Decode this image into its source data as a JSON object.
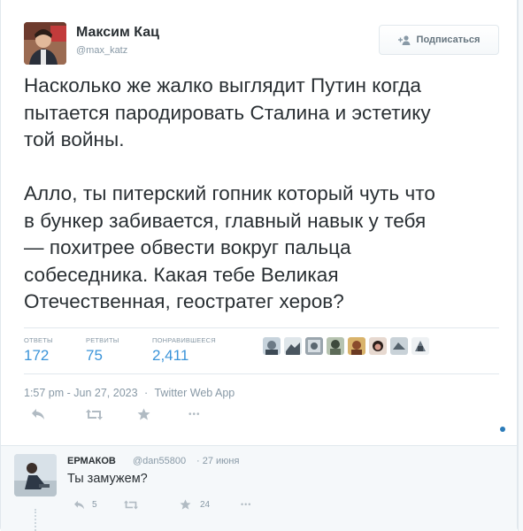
{
  "user": {
    "name": "Максим Кац",
    "handle": "@max_katz",
    "follow_label": "Подписаться"
  },
  "tweet": {
    "text": "Насколько же жалко выглядит Путин когда\nпытается пародировать Сталина и эстетику\nтой войны.\n\nАлло, ты питерский гопник который чуть что\nв бункер забивается, главный навык у тебя\n— похитрее обвести вокруг пальца\nсобеседника. Какая тебе Великая\nОтечественная, геостратег херов?"
  },
  "stats": {
    "replies_label": "ОТВЕТЫ",
    "replies_value": "172",
    "retweets_label": "РЕТВИТЫ",
    "retweets_value": "75",
    "likes_label": "ПОНРАВИВШЕЕСЯ",
    "likes_value": "2,411"
  },
  "meta": {
    "timestamp": "1:57 pm - Jun 27, 2023",
    "separator": "·",
    "source": "Twitter Web App"
  },
  "actions": {
    "reply_icon": "reply-icon",
    "retweet_icon": "retweet-icon",
    "like_icon": "star-icon",
    "more_icon": "more-dots-icon",
    "more_label": "•••"
  },
  "reply": {
    "name": "ЕРМАКОВ",
    "handle": "@dan55800",
    "separator": "·",
    "date": "27 июня",
    "text": "Ты замужем?",
    "reply_count": "5",
    "like_count": "24",
    "more_label": "•••"
  },
  "colors": {
    "accent": "#3b94d9",
    "text": "#292f33",
    "muted": "#8899a6",
    "border": "#e1e8ed",
    "panel": "#f5f8fa"
  }
}
